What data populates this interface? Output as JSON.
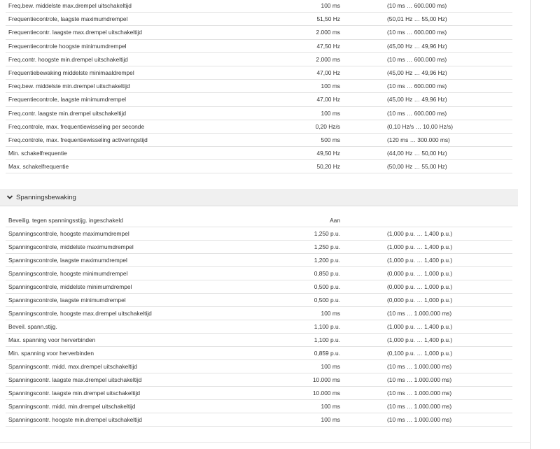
{
  "frequency_rows": [
    {
      "name": "Freq.bew. middelste max.drempel uitschakeltijd",
      "value": "100 ms",
      "range": "(10 ms … 600.000 ms)"
    },
    {
      "name": "Frequentiecontrole, laagste maximumdrempel",
      "value": "51,50 Hz",
      "range": "(50,01 Hz … 55,00 Hz)"
    },
    {
      "name": "Frequentiecontr. laagste max.drempel uitschakeltijd",
      "value": "2.000 ms",
      "range": "(10 ms … 600.000 ms)"
    },
    {
      "name": "Frequentiecontrole hoogste minimumdrempel",
      "value": "47,50 Hz",
      "range": "(45,00 Hz … 49,96 Hz)"
    },
    {
      "name": "Freq.contr. hoogste min.drempel uitschakeltijd",
      "value": "2.000 ms",
      "range": "(10 ms … 600.000 ms)"
    },
    {
      "name": "Frequentiebewaking middelste minimaaldrempel",
      "value": "47,00 Hz",
      "range": "(45,00 Hz … 49,96 Hz)"
    },
    {
      "name": "Freq.bew. middelste min.drempel uitschakeltijd",
      "value": "100 ms",
      "range": "(10 ms … 600.000 ms)"
    },
    {
      "name": "Frequentiecontrole, laagste minimumdrempel",
      "value": "47,00 Hz",
      "range": "(45,00 Hz … 49,96 Hz)"
    },
    {
      "name": "Freq.contr. laagste min.drempel uitschakeltijd",
      "value": "100 ms",
      "range": "(10 ms … 600.000 ms)"
    },
    {
      "name": "Freq.controle, max. frequentiewisseling per seconde",
      "value": "0,20 Hz/s",
      "range": "(0,10 Hz/s … 10,00 Hz/s)"
    },
    {
      "name": "Freq.controle, max. frequentiewisseling activeringstijd",
      "value": "500 ms",
      "range": "(120 ms … 300.000 ms)"
    },
    {
      "name": "Min. schakelfrequentie",
      "value": "49,50 Hz",
      "range": "(44,00 Hz … 50,00 Hz)"
    },
    {
      "name": "Max. schakelfrequentie",
      "value": "50,20 Hz",
      "range": "(50,00 Hz … 55,00 Hz)"
    }
  ],
  "voltage_section": {
    "title": "Spanningsbewaking",
    "icon": "chevron-down-icon",
    "rows": [
      {
        "name": "Beveilig. tegen spanningsstijg. ingeschakeld",
        "value": "Aan",
        "range": ""
      },
      {
        "name": "Spanningscontrole, hoogste maximumdrempel",
        "value": "1,250 p.u.",
        "range": "(1,000 p.u. … 1,400 p.u.)"
      },
      {
        "name": "Spanningscontrole, middelste maximumdrempel",
        "value": "1,250 p.u.",
        "range": "(1,000 p.u. … 1,400 p.u.)"
      },
      {
        "name": "Spanningscontrole, laagste maximumdrempel",
        "value": "1,200 p.u.",
        "range": "(1,000 p.u. … 1,400 p.u.)"
      },
      {
        "name": "Spanningscontrole, hoogste minimumdrempel",
        "value": "0,850 p.u.",
        "range": "(0,000 p.u. … 1,000 p.u.)"
      },
      {
        "name": "Spanningscontrole, middelste minimumdrempel",
        "value": "0,500 p.u.",
        "range": "(0,000 p.u. … 1,000 p.u.)"
      },
      {
        "name": "Spanningscontrole, laagste minimumdrempel",
        "value": "0,500 p.u.",
        "range": "(0,000 p.u. … 1,000 p.u.)"
      },
      {
        "name": "Spanningscontrole, hoogste max.drempel uitschakeltijd",
        "value": "100 ms",
        "range": "(10 ms … 1.000.000 ms)"
      },
      {
        "name": "Beveil. spann.stijg.",
        "value": "1,100 p.u.",
        "range": "(1,000 p.u. … 1,400 p.u.)"
      },
      {
        "name": "Max. spanning voor herverbinden",
        "value": "1,100 p.u.",
        "range": "(1,000 p.u. … 1,400 p.u.)"
      },
      {
        "name": "Min. spanning voor herverbinden",
        "value": "0,859 p.u.",
        "range": "(0,100 p.u. … 1,000 p.u.)"
      },
      {
        "name": "Spanningscontr. midd. max.drempel uitschakeltijd",
        "value": "100 ms",
        "range": "(10 ms … 1.000.000 ms)"
      },
      {
        "name": "Spanningscontr. laagste max.drempel uitschakeltijd",
        "value": "10.000 ms",
        "range": "(10 ms … 1.000.000 ms)"
      },
      {
        "name": "Spanningscontr. laagste min.drempel uitschakeltijd",
        "value": "10.000 ms",
        "range": "(10 ms … 1.000.000 ms)"
      },
      {
        "name": "Spanningscontr. midd. min.drempel uitschakeltijd",
        "value": "100 ms",
        "range": "(10 ms … 1.000.000 ms)"
      },
      {
        "name": "Spanningscontr. hoogste min.drempel uitschakeltijd",
        "value": "100 ms",
        "range": "(10 ms … 1.000.000 ms)"
      }
    ]
  },
  "colors": {
    "header_bg": "#f0f0f0",
    "row_divider": "#e2e2e2",
    "text": "#333333"
  }
}
